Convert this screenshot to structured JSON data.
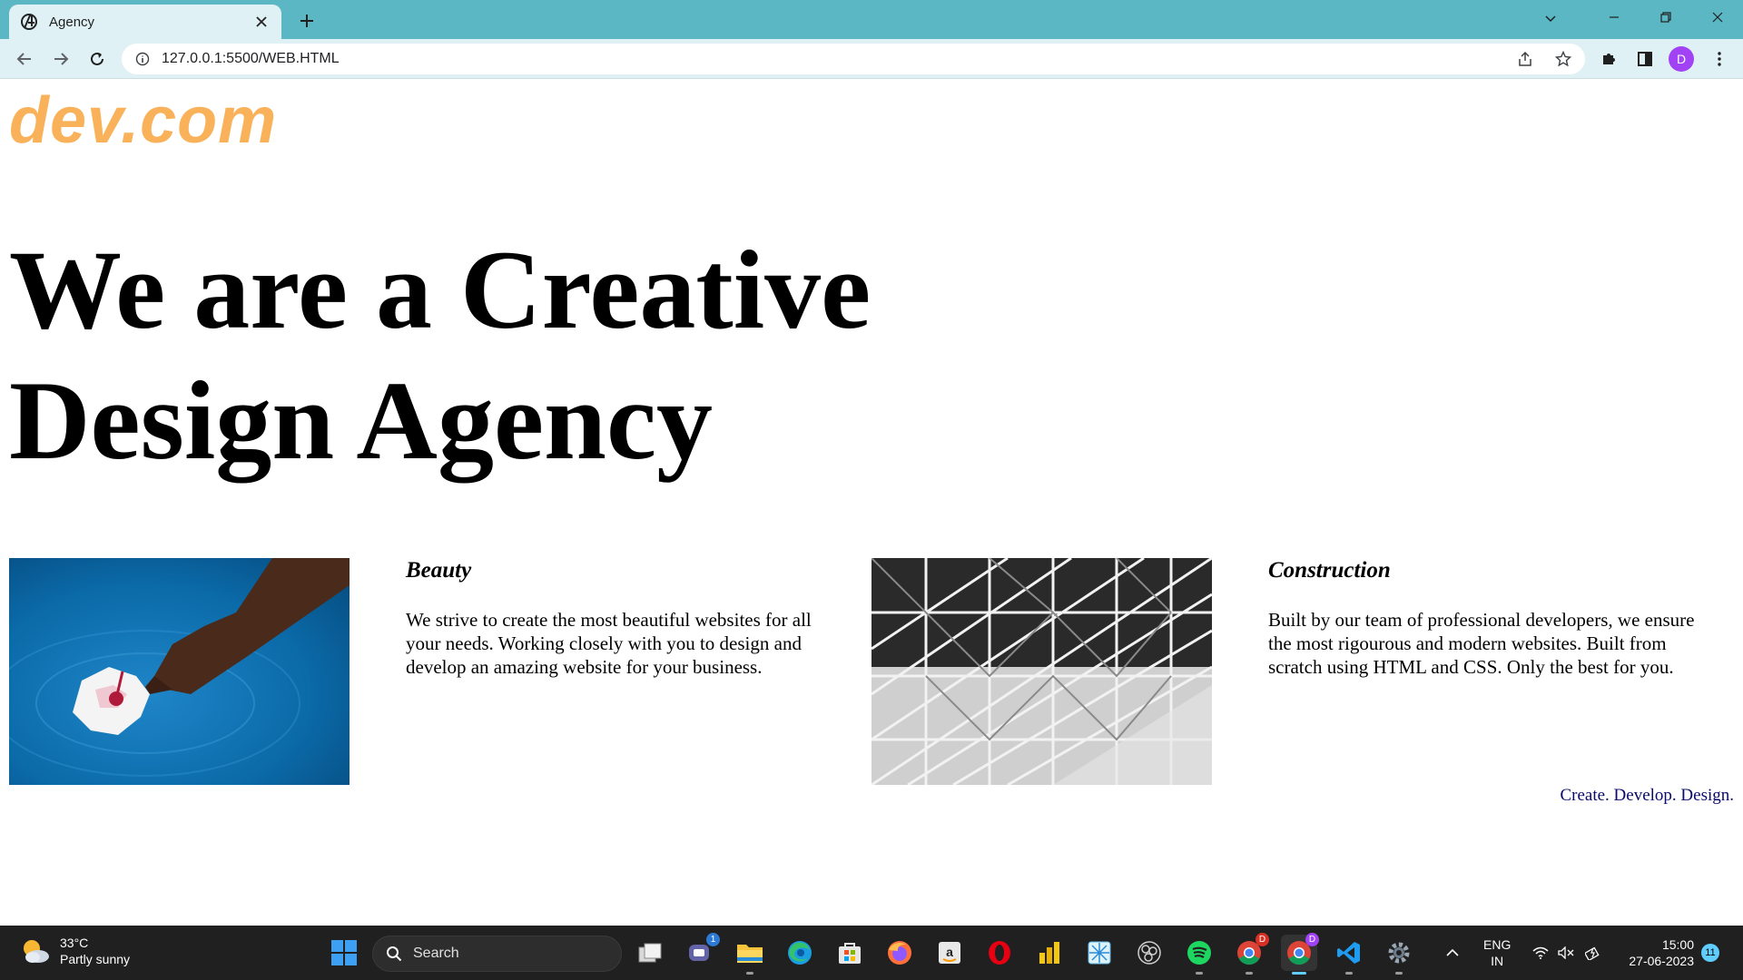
{
  "browser": {
    "tab_title": "Agency",
    "url": "127.0.0.1:5500/WEB.HTML",
    "profile_initial": "D",
    "theme_color": "#5bb7c3"
  },
  "page": {
    "logo": "dev.com",
    "logo_color": "#f9b15a",
    "hero_line1": "We are a Creative",
    "hero_line2": "Design Agency",
    "features": [
      {
        "title": "Beauty",
        "text": "We strive to create the most beautiful websites for all your needs. Working closely with you to design and develop an amazing website for your business.",
        "image": "hand-touching-flower-in-water"
      },
      {
        "title": "Construction",
        "text": "Built by our team of professional developers, we ensure the most rigourous and modern websites. Built from scratch using HTML and CSS. Only the best for you.",
        "image": "steel-structure-black-and-white"
      }
    ],
    "tagline": "Create. Develop. Design."
  },
  "taskbar": {
    "weather_temp": "33°C",
    "weather_desc": "Partly sunny",
    "search_label": "Search",
    "lang_line1": "ENG",
    "lang_line2": "IN",
    "time": "15:00",
    "date": "27-06-2023",
    "notification_count": "11",
    "teams_badge": "1",
    "chrome_badge_1": "D",
    "chrome_badge_2": "D"
  }
}
